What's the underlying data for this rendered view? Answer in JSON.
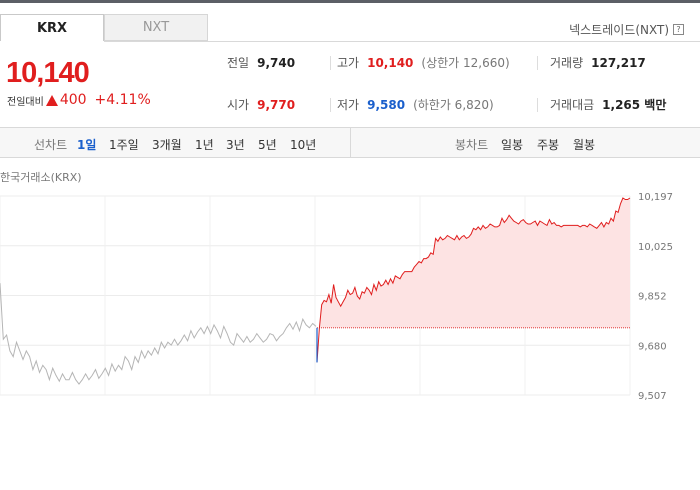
{
  "tabs": {
    "krx": "KRX",
    "nxt": "NXT"
  },
  "nextrade_link": "넥스트레이드(NXT)",
  "help_icon": "question-icon",
  "price": {
    "current": "10,140",
    "change_label": "전일대비",
    "change_value": "400",
    "change_pct": "+4.11%",
    "direction": "up"
  },
  "stats": {
    "prev_close": {
      "label": "전일",
      "value": "9,740"
    },
    "high": {
      "label": "고가",
      "value": "10,140",
      "sub": "(상한가 12,660)"
    },
    "volume": {
      "label": "거래량",
      "value": "127,217"
    },
    "open": {
      "label": "시가",
      "value": "9,770"
    },
    "low": {
      "label": "저가",
      "value": "9,580",
      "sub": "(하한가 6,820)"
    },
    "amount": {
      "label": "거래대금",
      "value": "1,265 백만"
    }
  },
  "toolbar": {
    "line_chart_label": "선차트",
    "periods": [
      "1일",
      "1주일",
      "3개월",
      "1년",
      "3년",
      "5년",
      "10년"
    ],
    "active_period": "1일",
    "candle_chart_label": "봉차트",
    "candles": [
      "일봉",
      "주봉",
      "월봉"
    ]
  },
  "chart_source_label": "한국거래소(KRX)",
  "colors": {
    "up": "#e01e1e",
    "down": "#1a5fcc",
    "pre_market": "#b5b5b5",
    "fill": "#fde3e3"
  },
  "chart_data": {
    "type": "line",
    "y_ticks": [
      "10,197",
      "10,025",
      "9,852",
      "9,680",
      "9,507"
    ],
    "ylim": [
      9507,
      10197
    ],
    "reference_price": 9740,
    "grid": true,
    "series": [
      {
        "values": [
          9895,
          9700,
          9715,
          9660,
          9640,
          9690,
          9660,
          9630,
          9660,
          9640,
          9595,
          9625,
          9585,
          9610,
          9595,
          9560,
          9600,
          9575,
          9555,
          9580,
          9560,
          9560,
          9585,
          9560,
          9545,
          9560,
          9580,
          9560,
          9575,
          9595,
          9565,
          9580,
          9600,
          9575,
          9615,
          9590,
          9610,
          9595,
          9640,
          9625,
          9595,
          9640,
          9620,
          9660,
          9635,
          9660,
          9645,
          9670,
          9650,
          9690,
          9670,
          9690,
          9680,
          9700,
          9680,
          9695,
          9715,
          9695,
          9730,
          9705,
          9725,
          9740,
          9720,
          9745,
          9720,
          9750,
          9730,
          9705,
          9745,
          9720,
          9690,
          9680,
          9720,
          9705,
          9690,
          9710,
          9690,
          9700,
          9720,
          9705,
          9690,
          9700,
          9720,
          9715,
          9695,
          9710,
          9720,
          9740,
          9755,
          9735,
          9760,
          9730,
          9770,
          9750,
          9740,
          9755,
          9745
        ]
      },
      {
        "values": [
          9620,
          9740,
          9820,
          9835,
          9830,
          9855,
          9825,
          9890,
          9845,
          9830,
          9815,
          9830,
          9845,
          9870,
          9855,
          9860,
          9880,
          9850,
          9840,
          9865,
          9860,
          9880,
          9870,
          9855,
          9890,
          9870,
          9900,
          9885,
          9890,
          9905,
          9890,
          9910,
          9895,
          9920,
          9915,
          9910,
          9925,
          9935,
          9935,
          9935,
          9935,
          9950,
          9960,
          9970,
          9965,
          9980,
          9980,
          9985,
          10000,
          9995,
          10050,
          10040,
          10055,
          10045,
          10050,
          10060,
          10055,
          10050,
          10045,
          10060,
          10045,
          10055,
          10060,
          10050,
          10055,
          10065,
          10085,
          10080,
          10090,
          10080,
          10095,
          10085,
          10090,
          10100,
          10095,
          10090,
          10090,
          10095,
          10120,
          10105,
          10115,
          10130,
          10120,
          10110,
          10105,
          10100,
          10110,
          10115,
          10105,
          10100,
          10100,
          10105,
          10110,
          10095,
          10110,
          10105,
          10100,
          10095,
          10115,
          10100,
          10105,
          10095,
          10095,
          10090,
          10095,
          10095,
          10095,
          10095,
          10095,
          10095,
          10095,
          10090,
          10095,
          10095,
          10090,
          10100,
          10095,
          10090,
          10085,
          10095,
          10105,
          10090,
          10105,
          10100,
          10120,
          10110,
          10145,
          10140,
          10170,
          10190,
          10185,
          10185,
          10190
        ]
      }
    ]
  }
}
